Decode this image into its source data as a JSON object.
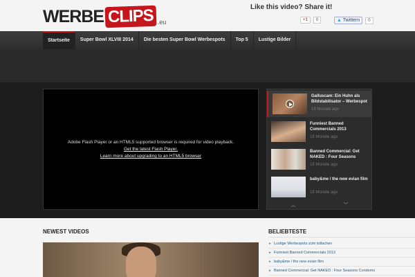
{
  "header": {
    "logo_text_1": "WERBE",
    "logo_text_2": "CLIPS",
    "logo_suffix": ".eu",
    "share_title": "Like this video? Share it!",
    "gplus_label": "+1",
    "gplus_count": "0",
    "twitter_label": "Twittern",
    "twitter_count": "0"
  },
  "nav": {
    "items": [
      {
        "label": "Startseite"
      },
      {
        "label": "Super Bowl XLVIII 2014"
      },
      {
        "label": "Die besten Super Bowl Werbespots"
      },
      {
        "label": "Top 5"
      },
      {
        "label": "Lustige Bilder"
      }
    ]
  },
  "player": {
    "message_line1": "Adobe Flash Player or an HTML5 supported browser is required for video playback.",
    "link_flash": "Get the latest Flash Player.",
    "link_html5": "Learn more about upgrading to an HTML5 browser"
  },
  "slider": {
    "items": [
      {
        "title": "Galluscam: Ein Huhn als Bildstabilisator – Werbespot",
        "date": "18 Monate ago"
      },
      {
        "title": "Funniest Banned Commercials 2013",
        "date": "18 Monate ago"
      },
      {
        "title": "Banned Commercial: Get NAKED : Four Seasons",
        "date": "18 Monate ago"
      },
      {
        "title": "baby&me / the new evian film",
        "date": "18 Monate ago"
      }
    ],
    "up_arrow": "︿",
    "down_arrow": "﹀"
  },
  "sections": {
    "newest_title": "NEWEST VIDEOS",
    "beliebteste_title": "BELIEBTESTE"
  },
  "beliebteste": {
    "items": [
      {
        "label": "Lustige Werbespots zum totlachen"
      },
      {
        "label": "Funniest Banned Commercials 2013"
      },
      {
        "label": "baby&me / the new evian film"
      },
      {
        "label": "Banned Commercial: Get NAKED : Four Seasons Condoms"
      }
    ]
  },
  "colors": {
    "accent": "#c4161c",
    "nav_bg": "#333333",
    "link": "#1e5a86"
  }
}
